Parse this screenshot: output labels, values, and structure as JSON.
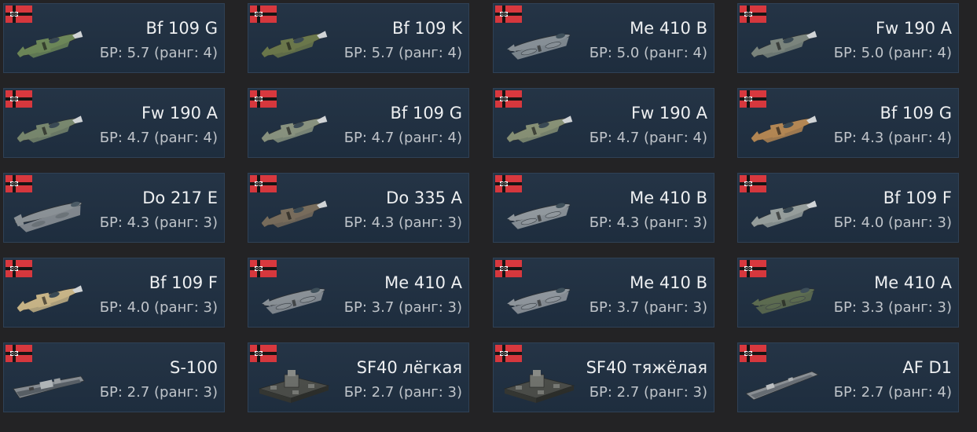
{
  "cards": [
    {
      "name": "Bf 109 G",
      "br": "БР: 5.7 (ранг: 4)",
      "icon": "fighter-plane-icon",
      "camo": "#6f8a5a"
    },
    {
      "name": "Bf 109 K",
      "br": "БР: 5.7 (ранг: 4)",
      "icon": "fighter-plane-icon",
      "camo": "#6d7a4c"
    },
    {
      "name": "Me 410 B",
      "br": "БР: 5.0 (ранг: 4)",
      "icon": "twin-engine-plane-icon",
      "camo": "#8a939a"
    },
    {
      "name": "Fw 190 A",
      "br": "БР: 5.0 (ранг: 4)",
      "icon": "fighter-plane-icon",
      "camo": "#7e8880"
    },
    {
      "name": "Fw 190 A",
      "br": "БР: 4.7 (ранг: 4)",
      "icon": "fighter-plane-icon",
      "camo": "#7a8a70"
    },
    {
      "name": "Bf 109 G",
      "br": "БР: 4.7 (ранг: 4)",
      "icon": "fighter-plane-icon",
      "camo": "#8c9682"
    },
    {
      "name": "Fw 190 A",
      "br": "БР: 4.7 (ранг: 4)",
      "icon": "fighter-plane-icon",
      "camo": "#8a9478"
    },
    {
      "name": "Bf 109 G",
      "br": "БР: 4.3 (ранг: 4)",
      "icon": "fighter-plane-icon",
      "camo": "#b88a55"
    },
    {
      "name": "Do 217 E",
      "br": "БР: 4.3 (ранг: 3)",
      "icon": "bomber-plane-icon",
      "camo": "#8e959a"
    },
    {
      "name": "Do 335 A",
      "br": "БР: 4.3 (ранг: 3)",
      "icon": "fighter-plane-icon",
      "camo": "#7b6f5e"
    },
    {
      "name": "Me 410 B",
      "br": "БР: 4.3 (ранг: 3)",
      "icon": "twin-engine-plane-icon",
      "camo": "#959ca2"
    },
    {
      "name": "Bf 109 F",
      "br": "БР: 4.0 (ранг: 3)",
      "icon": "fighter-plane-icon",
      "camo": "#9aa2a0"
    },
    {
      "name": "Bf 109 F",
      "br": "БР: 4.0 (ранг: 3)",
      "icon": "fighter-plane-icon",
      "camo": "#cdb98a"
    },
    {
      "name": "Me 410 A",
      "br": "БР: 3.7 (ранг: 3)",
      "icon": "twin-engine-plane-icon",
      "camo": "#8d949a"
    },
    {
      "name": "Me 410 B",
      "br": "БР: 3.7 (ранг: 3)",
      "icon": "twin-engine-plane-icon",
      "camo": "#9299a0"
    },
    {
      "name": "Me 410 A",
      "br": "БР: 3.3 (ранг: 3)",
      "icon": "twin-engine-plane-icon",
      "camo": "#5e6e52"
    },
    {
      "name": "S-100",
      "br": "БР: 2.7 (ранг: 3)",
      "icon": "torpedo-boat-icon",
      "camo": "#8a9096"
    },
    {
      "name": "SF40 лёгкая",
      "br": "БР: 2.7 (ранг: 3)",
      "icon": "ferry-barge-icon",
      "camo": "#6e706c"
    },
    {
      "name": "SF40 тяжёлая",
      "br": "БР: 2.7 (ранг: 3)",
      "icon": "ferry-barge-icon",
      "camo": "#72746f"
    },
    {
      "name": "AF D1",
      "br": "БР: 2.7 (ранг: 4)",
      "icon": "landing-craft-icon",
      "camo": "#8f9499"
    }
  ],
  "colors": {
    "background": "#232325",
    "card": "#203042",
    "card_border": "#2f4156",
    "flag_red": "#d8353b",
    "flag_black": "#111111"
  }
}
